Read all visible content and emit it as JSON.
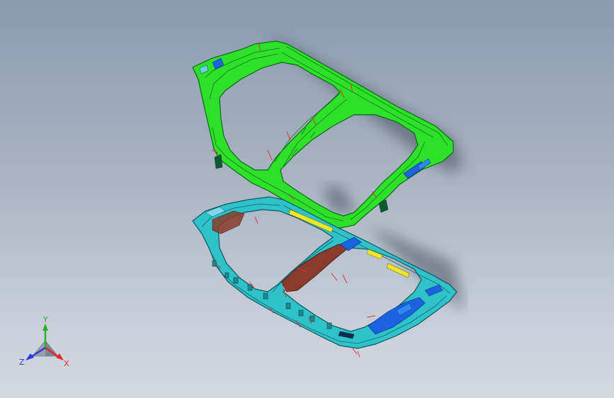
{
  "viewport": {
    "background_top": "#8a9bb0",
    "background_bottom": "#d4d8df"
  },
  "model": {
    "upper_frame_color": "#2ee02a",
    "upper_frame_edge": "#0a6a10",
    "lower_frame_color": "#2fc2c8",
    "lower_frame_edge": "#0b5560",
    "accent_yellow": "#f0e62a",
    "accent_blue": "#1b63e0",
    "accent_brown": "#8a3b2c",
    "marker_red": "#e0303a"
  },
  "triad": {
    "x_label": "X",
    "y_label": "Y",
    "z_label": "Z",
    "x_color": "#e02a2a",
    "y_color": "#2ab02a",
    "z_color": "#2a3ae0"
  }
}
